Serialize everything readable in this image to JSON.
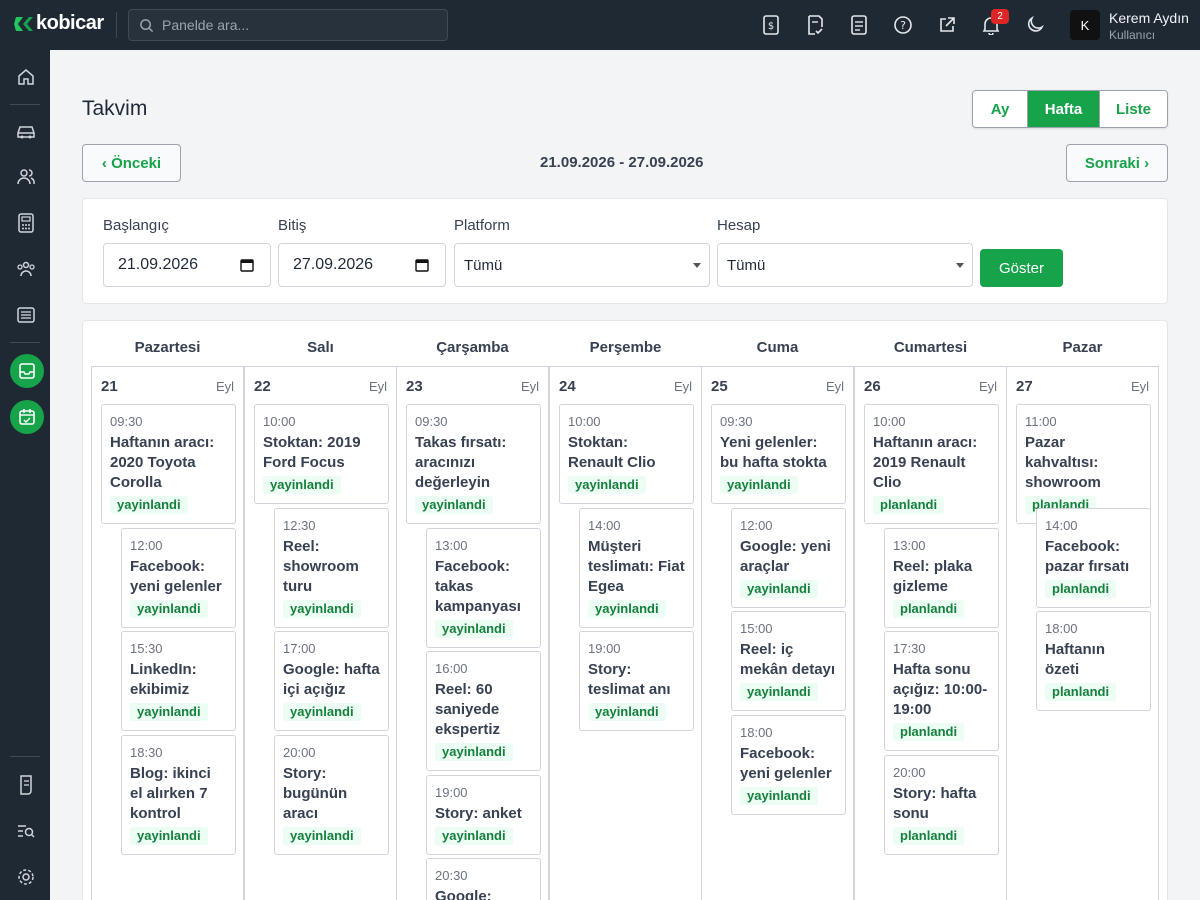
{
  "topbar": {
    "brand": "kobicar",
    "search_placeholder": "Panelde ara...",
    "notification_count": "2",
    "user_initial": "K",
    "user_name": "Kerem Aydın",
    "user_role": "Kullanıcı",
    "icons": [
      "invoice-icon",
      "document-check-icon",
      "document-icon",
      "help-icon",
      "external-link-icon",
      "bell-icon",
      "moon-icon"
    ]
  },
  "sidebar": {
    "items": [
      "home-icon",
      "car-icon",
      "users-icon",
      "calculator-icon",
      "team-icon",
      "list-icon",
      "inbox-icon",
      "calendar-car-icon",
      "report-icon",
      "search-list-icon",
      "settings-icon"
    ],
    "accent": "#16a34a"
  },
  "page": {
    "title": "Takvim",
    "views": [
      "Ay",
      "Hafta",
      "Liste"
    ],
    "active_view": "Hafta",
    "prev_label": "‹ Önceki",
    "next_label": "Sonraki ›",
    "date_range": "21.09.2026 - 27.09.2026"
  },
  "filters": {
    "start_label": "Başlangıç",
    "start_value": "21.09.2026",
    "end_label": "Bitiş",
    "end_value": "27.09.2026",
    "platform_label": "Platform",
    "platform_value": "Tümü",
    "account_label": "Hesap",
    "account_value": "Tümü",
    "show_label": "Göster"
  },
  "days": [
    {
      "name": "Pazartesi",
      "num": "21",
      "mon": "Eyl",
      "events": [
        {
          "time": "09:30",
          "title": "Haftanın aracı: 2020 Toyota Corolla",
          "status": "yayinlandi"
        },
        {
          "time": "12:00",
          "title": "Facebook: yeni gelenler",
          "status": "yayinlandi"
        },
        {
          "time": "15:30",
          "title": "LinkedIn: ekibimiz",
          "status": "yayinlandi"
        },
        {
          "time": "18:30",
          "title": "Blog: ikinci el alırken 7 kontrol",
          "status": "yayinlandi"
        }
      ]
    },
    {
      "name": "Salı",
      "num": "22",
      "mon": "Eyl",
      "events": [
        {
          "time": "10:00",
          "title": "Stoktan: 2019 Ford Focus",
          "status": "yayinlandi"
        },
        {
          "time": "12:30",
          "title": "Reel: showroom turu",
          "status": "yayinlandi"
        },
        {
          "time": "17:00",
          "title": "Google: hafta içi açığız",
          "status": "yayinlandi"
        },
        {
          "time": "20:00",
          "title": "Story: bugünün aracı",
          "status": "yayinlandi"
        }
      ]
    },
    {
      "name": "Çarşamba",
      "num": "23",
      "mon": "Eyl",
      "events": [
        {
          "time": "09:30",
          "title": "Takas fırsatı: aracınızı değerleyin",
          "status": "yayinlandi"
        },
        {
          "time": "13:00",
          "title": "Facebook: takas kampanyası",
          "status": "yayinlandi"
        },
        {
          "time": "16:00",
          "title": "Reel: 60 saniyede ekspertiz",
          "status": "yayinlandi"
        },
        {
          "time": "19:00",
          "title": "Story: anket",
          "status": "yayinlandi"
        },
        {
          "time": "20:30",
          "title": "Google:",
          "status": ""
        }
      ]
    },
    {
      "name": "Perşembe",
      "num": "24",
      "mon": "Eyl",
      "events": [
        {
          "time": "10:00",
          "title": "Stoktan: Renault Clio",
          "status": "yayinlandi"
        },
        {
          "time": "14:00",
          "title": "Müşteri teslimatı: Fiat Egea",
          "status": "yayinlandi"
        },
        {
          "time": "19:00",
          "title": "Story: teslimat anı",
          "status": "yayinlandi"
        }
      ]
    },
    {
      "name": "Cuma",
      "num": "25",
      "mon": "Eyl",
      "events": [
        {
          "time": "09:30",
          "title": "Yeni gelenler: bu hafta stokta",
          "status": "yayinlandi"
        },
        {
          "time": "12:00",
          "title": "Google: yeni araçlar",
          "status": "yayinlandi"
        },
        {
          "time": "15:00",
          "title": "Reel: iç mekân detayı",
          "status": "yayinlandi"
        },
        {
          "time": "18:00",
          "title": "Facebook: yeni gelenler",
          "status": "yayinlandi"
        }
      ]
    },
    {
      "name": "Cumartesi",
      "num": "26",
      "mon": "Eyl",
      "events": [
        {
          "time": "10:00",
          "title": "Haftanın aracı: 2019 Renault Clio",
          "status": "planlandi"
        },
        {
          "time": "13:00",
          "title": "Reel: plaka gizleme",
          "status": "planlandi"
        },
        {
          "time": "17:30",
          "title": "Hafta sonu açığız: 10:00-19:00",
          "status": "planlandi"
        },
        {
          "time": "20:00",
          "title": "Story: hafta sonu",
          "status": "planlandi"
        }
      ]
    },
    {
      "name": "Pazar",
      "num": "27",
      "mon": "Eyl",
      "events": [
        {
          "time": "11:00",
          "title": "Pazar kahvaltısı: showroom",
          "status": "planlandi"
        },
        {
          "time": "14:00",
          "title": "Facebook: pazar fırsatı",
          "status": "planlandi"
        },
        {
          "time": "18:00",
          "title": "Haftanın özeti",
          "status": "planlandi"
        }
      ]
    }
  ]
}
